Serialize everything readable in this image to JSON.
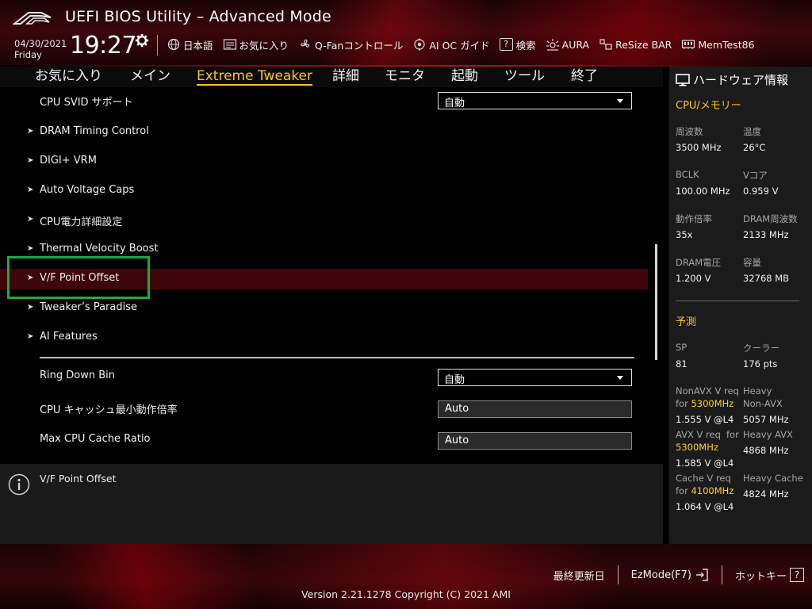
{
  "header": {
    "title": "UEFI BIOS Utility – Advanced Mode",
    "date": "04/30/2021",
    "weekday": "Friday",
    "time": "19:27",
    "toolbar": [
      {
        "icon": "globe-icon",
        "label": "日本語"
      },
      {
        "icon": "favorites-icon",
        "label": "お気に入り"
      },
      {
        "icon": "fan-icon",
        "label": "Q-Fanコントロール"
      },
      {
        "icon": "ai-oc-icon",
        "label": "AI OC ガイド"
      },
      {
        "icon": "help-search-icon",
        "glyph": "?",
        "label": "検索"
      },
      {
        "icon": "aura-icon",
        "label": "AURA"
      },
      {
        "icon": "resize-bar-icon",
        "label": "ReSize BAR"
      },
      {
        "icon": "memtest-icon",
        "label": "MemTest86"
      }
    ]
  },
  "tabs": [
    {
      "label": "お気に入り",
      "active": false
    },
    {
      "label": "メイン",
      "active": false
    },
    {
      "label": "Extreme Tweaker",
      "active": true
    },
    {
      "label": "詳細",
      "active": false
    },
    {
      "label": "モニタ",
      "active": false
    },
    {
      "label": "起動",
      "active": false
    },
    {
      "label": "ツール",
      "active": false
    },
    {
      "label": "終了",
      "active": false
    }
  ],
  "settings": {
    "cpu_svid": {
      "label": "CPU SVID サポート",
      "value": "自動"
    },
    "submenus": [
      {
        "label": "DRAM Timing Control"
      },
      {
        "label": "DIGI+ VRM"
      },
      {
        "label": "Auto Voltage Caps"
      },
      {
        "label": "CPU電力詳細設定"
      },
      {
        "label": "Thermal Velocity Boost"
      },
      {
        "label": "V/F Point Offset",
        "selected": true
      },
      {
        "label": "Tweaker’s Paradise"
      },
      {
        "label": "AI Features"
      }
    ],
    "ring_down_bin": {
      "label": "Ring Down Bin",
      "value": "自動"
    },
    "cache_min_ratio": {
      "label": "CPU キャッシュ最小動作倍率",
      "value": "Auto"
    },
    "max_cache_ratio": {
      "label": "Max CPU Cache Ratio",
      "value": "Auto"
    }
  },
  "help": {
    "text": "V/F Point Offset"
  },
  "hardware": {
    "title": "ハードウェア情報",
    "cpu_mem_section": "CPU/メモリー",
    "cpu_mem": [
      {
        "k1": "周波数",
        "v1": "3500 MHz",
        "k2": "温度",
        "v2": "26°C"
      },
      {
        "k1": "BCLK",
        "v1": "100.00 MHz",
        "k2": "Vコア",
        "v2": "0.959 V"
      },
      {
        "k1": "動作倍率",
        "v1": "35x",
        "k2": "DRAM周波数",
        "v2": "2133 MHz"
      },
      {
        "k1": "DRAM電圧",
        "v1": "1.200 V",
        "k2": "容量",
        "v2": "32768 MB"
      }
    ],
    "prediction_section": "予測",
    "sp": {
      "k": "SP",
      "v": "81"
    },
    "cooler": {
      "k": "クーラー",
      "v": "176 pts"
    },
    "nonavx": {
      "k_line1": "NonAVX V req",
      "k_for": "for ",
      "k_freq": "5300MHz",
      "v": "1.555 V @L4",
      "hk1": "Heavy",
      "hk2": "Non-AVX",
      "hv": "5057 MHz"
    },
    "avx": {
      "k_line1": "AVX V req",
      "k_for": "for",
      "k_freq": "5300MHz",
      "v": "1.585 V @L4",
      "hk1": "Heavy AVX",
      "hv": "4868 MHz"
    },
    "cache": {
      "k_line1": "Cache V req",
      "k_for": "for ",
      "k_freq": "4100MHz",
      "v": "1.064 V @L4",
      "hk1": "Heavy Cache",
      "hv": "4824 MHz"
    }
  },
  "footer": {
    "last_modified": "最終更新日",
    "ezmode": "EzMode(F7)",
    "hotkeys": "ホットキー",
    "hotkeys_glyph": "?",
    "version": "Version 2.21.1278 Copyright (C) 2021 AMI"
  }
}
